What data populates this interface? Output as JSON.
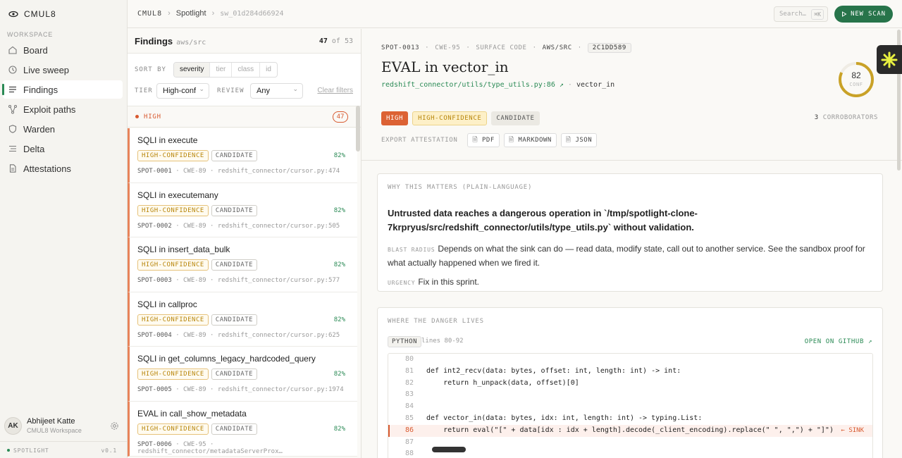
{
  "app": {
    "name": "CMUL8"
  },
  "sidebar": {
    "section_label": "WORKSPACE",
    "items": [
      {
        "label": "Board",
        "icon": "home-icon"
      },
      {
        "label": "Live sweep",
        "icon": "clock-icon"
      },
      {
        "label": "Findings",
        "icon": "list-icon",
        "active": true
      },
      {
        "label": "Exploit paths",
        "icon": "branch-icon"
      },
      {
        "label": "Warden",
        "icon": "shield-icon"
      },
      {
        "label": "Delta",
        "icon": "lines-icon"
      },
      {
        "label": "Attestations",
        "icon": "document-icon"
      }
    ],
    "user": {
      "initials": "AK",
      "name": "Abhijeet Katte",
      "workspace": "CMUL8 Workspace"
    },
    "footer": {
      "label": "SPOTLIGHT",
      "version": "v0.1"
    }
  },
  "topbar": {
    "breadcrumb": [
      "CMUL8",
      "Spotlight",
      "sw_01d284d66924"
    ],
    "search_placeholder": "Search…",
    "search_shortcut": "⌘K",
    "new_scan_label": "NEW SCAN"
  },
  "findings": {
    "title": "Findings",
    "scope": "aws/src",
    "count_shown": "47",
    "count_of": "of 53",
    "sort_label": "SORT BY",
    "sort_options": [
      "severity",
      "tier",
      "class",
      "id"
    ],
    "tier_label": "TIER",
    "tier_value": "High-conf",
    "review_label": "REVIEW",
    "review_value": "Any",
    "clear_label": "Clear filters",
    "severity_group": {
      "label": "HIGH",
      "count": "47"
    },
    "items": [
      {
        "title": "SQLI in execute",
        "tier": "HIGH-CONFIDENCE",
        "status": "CANDIDATE",
        "pct": "82%",
        "id": "SPOT-0001",
        "cwe": "CWE-89",
        "file": "redshift_connector/cursor.py:474"
      },
      {
        "title": "SQLI in executemany",
        "tier": "HIGH-CONFIDENCE",
        "status": "CANDIDATE",
        "pct": "82%",
        "id": "SPOT-0002",
        "cwe": "CWE-89",
        "file": "redshift_connector/cursor.py:505"
      },
      {
        "title": "SQLI in insert_data_bulk",
        "tier": "HIGH-CONFIDENCE",
        "status": "CANDIDATE",
        "pct": "82%",
        "id": "SPOT-0003",
        "cwe": "CWE-89",
        "file": "redshift_connector/cursor.py:577"
      },
      {
        "title": "SQLI in callproc",
        "tier": "HIGH-CONFIDENCE",
        "status": "CANDIDATE",
        "pct": "82%",
        "id": "SPOT-0004",
        "cwe": "CWE-89",
        "file": "redshift_connector/cursor.py:625"
      },
      {
        "title": "SQLI in get_columns_legacy_hardcoded_query",
        "tier": "HIGH-CONFIDENCE",
        "status": "CANDIDATE",
        "pct": "82%",
        "id": "SPOT-0005",
        "cwe": "CWE-89",
        "file": "redshift_connector/cursor.py:1974"
      },
      {
        "title": "EVAL in call_show_metadata",
        "tier": "HIGH-CONFIDENCE",
        "status": "CANDIDATE",
        "pct": "82%",
        "id": "SPOT-0006",
        "cwe": "CWE-95",
        "file": "redshift_connector/metadataServerProx…"
      }
    ]
  },
  "detail": {
    "id": "SPOT-0013",
    "cwe": "CWE-95",
    "surface": "SURFACE CODE",
    "scope": "AWS/SRC",
    "hash": "2C1DD589",
    "title": "EVAL in vector_in",
    "file_link": "redshift_connector/utils/type_utils.py:86 ↗",
    "symbol": "vector_in",
    "severity": "HIGH",
    "tier": "HIGH-CONFIDENCE",
    "status": "CANDIDATE",
    "corroborators_count": "3",
    "corroborators_label": "CORROBORATORS",
    "export_label": "EXPORT ATTESTATION",
    "export_pdf": "PDF",
    "export_md": "MARKDOWN",
    "export_json": "JSON",
    "confidence": "82",
    "confidence_label": "CONF",
    "confidence_fraction": 0.82,
    "why": {
      "title": "WHY THIS MATTERS (PLAIN-LANGUAGE)",
      "summary": "Untrusted data reaches a dangerous operation in `/tmp/spotlight-clone-7krpryus/src/redshift_connector/utils/type_utils.py` without validation.",
      "blast_label": "BLAST RADIUS",
      "blast": "Depends on what the sink can do — read data, modify state, call out to another service. See the sandbox proof for what actually happened when we fired it.",
      "urgency_label": "URGENCY",
      "urgency": "Fix in this sprint."
    },
    "code": {
      "title": "WHERE THE DANGER LIVES",
      "lang": "PYTHON",
      "range": "lines 80-92",
      "github": "OPEN ON GITHUB ↗",
      "sink_label": "← SINK",
      "lines": [
        {
          "n": "80",
          "t": ""
        },
        {
          "n": "81",
          "t": "def int2_recv(data: bytes, offset: int, length: int) -> int:"
        },
        {
          "n": "82",
          "t": "    return h_unpack(data, offset)[0]"
        },
        {
          "n": "83",
          "t": ""
        },
        {
          "n": "84",
          "t": ""
        },
        {
          "n": "85",
          "t": "def vector_in(data: bytes, idx: int, length: int) -> typing.List:"
        },
        {
          "n": "86",
          "t": "    return eval(\"[\" + data[idx : idx + length].decode(_client_encoding).replace(\" \", \",\") + \"]\")",
          "sink": true
        },
        {
          "n": "87",
          "t": ""
        },
        {
          "n": "88",
          "t": ""
        }
      ]
    }
  },
  "colors": {
    "accent": "#2a8a55",
    "high": "#dc6234",
    "conf": "#c9a227"
  }
}
